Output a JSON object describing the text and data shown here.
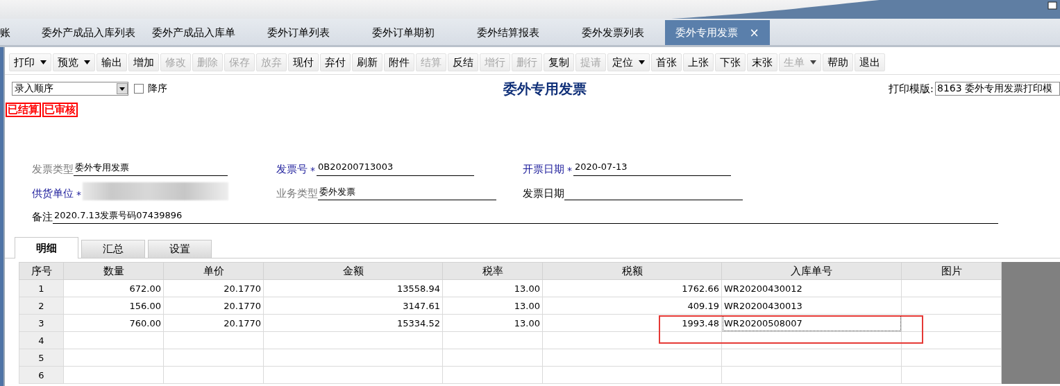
{
  "tabs": [
    {
      "label": "账",
      "selected": false
    },
    {
      "label": "委外产成品入库列表",
      "selected": false
    },
    {
      "label": "委外产成品入库单",
      "selected": false
    },
    {
      "label": "委外订单列表",
      "selected": false
    },
    {
      "label": "委外订单期初",
      "selected": false
    },
    {
      "label": "委外结算报表",
      "selected": false
    },
    {
      "label": "委外发票列表",
      "selected": false
    },
    {
      "label": "委外专用发票",
      "selected": true,
      "close": "×"
    }
  ],
  "toolbar": [
    {
      "label": "打印",
      "dropdown": true,
      "disabled": false
    },
    {
      "label": "预览",
      "dropdown": true,
      "disabled": false
    },
    {
      "label": "输出",
      "dropdown": false,
      "disabled": false
    },
    {
      "label": "增加",
      "dropdown": false,
      "disabled": false
    },
    {
      "label": "修改",
      "dropdown": false,
      "disabled": true
    },
    {
      "label": "删除",
      "dropdown": false,
      "disabled": true
    },
    {
      "label": "保存",
      "dropdown": false,
      "disabled": true
    },
    {
      "label": "放弃",
      "dropdown": false,
      "disabled": true
    },
    {
      "label": "现付",
      "dropdown": false,
      "disabled": false
    },
    {
      "label": "弃付",
      "dropdown": false,
      "disabled": false
    },
    {
      "label": "刷新",
      "dropdown": false,
      "disabled": false
    },
    {
      "label": "附件",
      "dropdown": false,
      "disabled": false
    },
    {
      "label": "结算",
      "dropdown": false,
      "disabled": true
    },
    {
      "label": "反结",
      "dropdown": false,
      "disabled": false
    },
    {
      "label": "增行",
      "dropdown": false,
      "disabled": true
    },
    {
      "label": "删行",
      "dropdown": false,
      "disabled": true
    },
    {
      "label": "复制",
      "dropdown": false,
      "disabled": false
    },
    {
      "label": "提请",
      "dropdown": false,
      "disabled": true
    },
    {
      "label": "定位",
      "dropdown": true,
      "disabled": false
    },
    {
      "label": "首张",
      "dropdown": false,
      "disabled": false
    },
    {
      "label": "上张",
      "dropdown": false,
      "disabled": false
    },
    {
      "label": "下张",
      "dropdown": false,
      "disabled": false
    },
    {
      "label": "末张",
      "dropdown": false,
      "disabled": false
    },
    {
      "label": "生单",
      "dropdown": true,
      "disabled": true
    },
    {
      "label": "帮助",
      "dropdown": false,
      "disabled": false
    },
    {
      "label": "退出",
      "dropdown": false,
      "disabled": false
    }
  ],
  "sort": {
    "value": "录入顺序",
    "descending": {
      "label": "降序",
      "checked": false
    }
  },
  "title": "委外专用发票",
  "print_template": {
    "label": "打印模版:",
    "value": "8163 委外专用发票打印模"
  },
  "stamps": [
    "已结算",
    "已审核"
  ],
  "fields": [
    [
      {
        "label": "发票类型",
        "kind": "readonly",
        "value": "委外专用发票"
      },
      {
        "label": "发票号",
        "kind": "required",
        "marker": "*",
        "value": "0B20200713003"
      },
      {
        "label": "开票日期",
        "kind": "required",
        "marker": "*",
        "value": "2020-07-13"
      }
    ],
    [
      {
        "label": "供货单位",
        "kind": "required",
        "marker": "*",
        "redacted": true
      },
      {
        "label": "业务类型",
        "kind": "readonly",
        "value": "委外发票"
      },
      {
        "label": "发票日期",
        "kind": "optional"
      }
    ]
  ],
  "remark": {
    "label": "备注",
    "value": "2020.7.13发票号码07439896"
  },
  "detail_tabs": [
    {
      "label": "明细",
      "selected": true
    },
    {
      "label": "汇总",
      "selected": false
    },
    {
      "label": "设置",
      "selected": false
    }
  ],
  "table": {
    "columns": [
      "序号",
      "数量",
      "单价",
      "金额",
      "税率",
      "税额",
      "入库单号",
      "图片"
    ],
    "rows": [
      {
        "no": "1",
        "qty": "672.00",
        "price": "20.1770",
        "amount": "13558.94",
        "tax_rate": "13.00",
        "tax": "1762.66",
        "receipt_no": "WR20200430012",
        "focused": false,
        "highlighted": false
      },
      {
        "no": "2",
        "qty": "156.00",
        "price": "20.1770",
        "amount": "3147.61",
        "tax_rate": "13.00",
        "tax": "409.19",
        "receipt_no": "WR20200430013",
        "focused": false,
        "highlighted": false
      },
      {
        "no": "3",
        "qty": "760.00",
        "price": "20.1770",
        "amount": "15334.52",
        "tax_rate": "13.00",
        "tax": "1993.48",
        "receipt_no": "WR20200508007",
        "focused": true,
        "highlighted": true
      },
      {
        "no": "4",
        "focused": false,
        "highlighted": false
      },
      {
        "no": "5",
        "focused": false,
        "highlighted": false
      },
      {
        "no": "6",
        "focused": false,
        "highlighted": false
      }
    ]
  }
}
